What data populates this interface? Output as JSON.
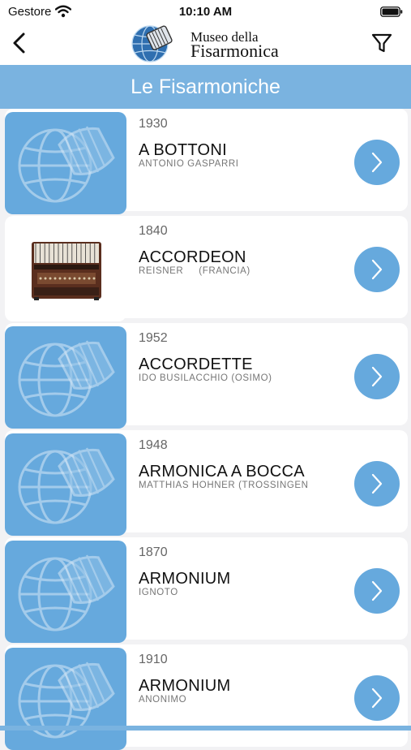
{
  "status": {
    "carrier": "Gestore",
    "time": "10:10 AM"
  },
  "nav": {
    "logo_line1": "Museo della",
    "logo_line2": "Fisarmonica"
  },
  "header": {
    "title": "Le Fisarmoniche"
  },
  "colors": {
    "accent": "#7ab3e0",
    "thumb": "#66a9dd"
  },
  "items": [
    {
      "year": "1930",
      "name": "A BOTTONI",
      "maker": "ANTONIO GASPARRI",
      "thumb": "placeholder-logo"
    },
    {
      "year": "1840",
      "name": "ACCORDEON",
      "maker": "REISNER     (FRANCIA)",
      "thumb": "accordion-photo"
    },
    {
      "year": "1952",
      "name": "ACCORDETTE",
      "maker": "IDO BUSILACCHIO (OSIMO)",
      "thumb": "placeholder-logo"
    },
    {
      "year": "1948",
      "name": "ARMONICA A BOCCA",
      "maker": "MATTHIAS HOHNER (TROSSINGEN",
      "thumb": "placeholder-logo"
    },
    {
      "year": "1870",
      "name": "ARMONIUM",
      "maker": "IGNOTO",
      "thumb": "placeholder-logo"
    },
    {
      "year": "1910",
      "name": "ARMONIUM",
      "maker": "ANONIMO",
      "thumb": "placeholder-logo"
    }
  ]
}
